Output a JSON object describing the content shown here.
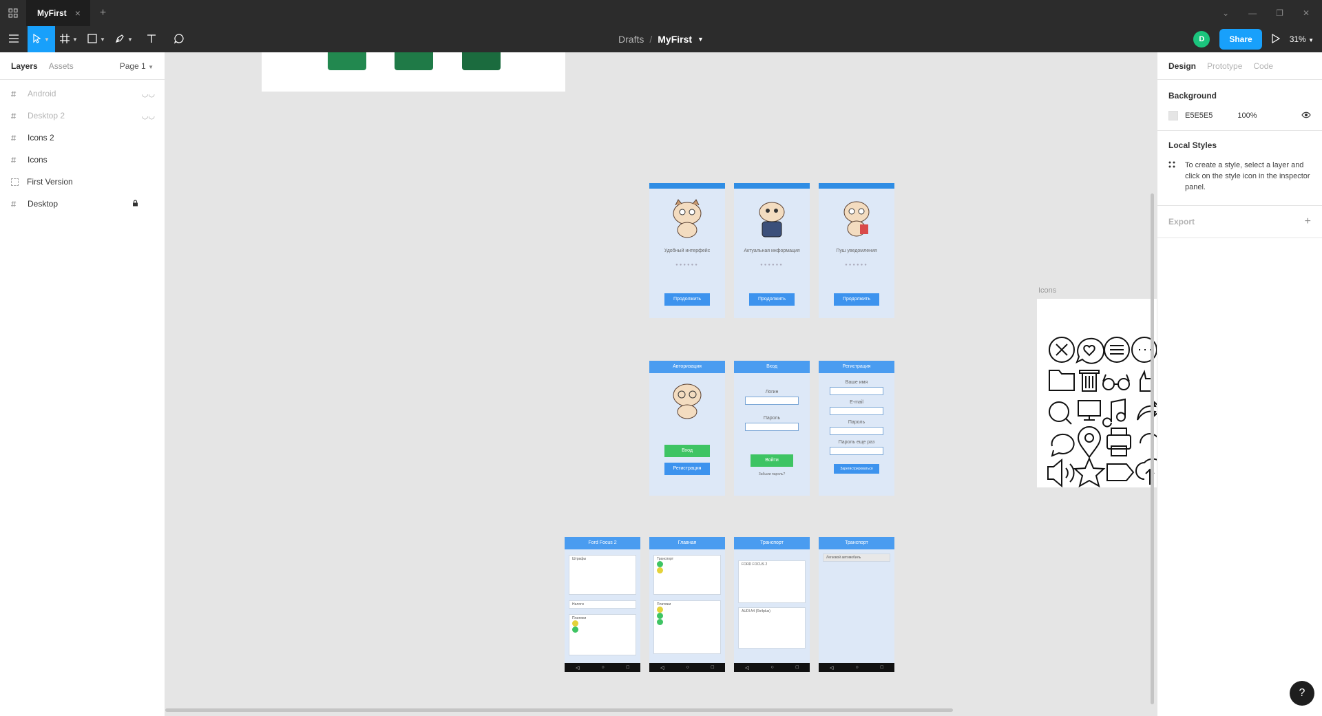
{
  "titlebar": {
    "tab_label": "MyFirst",
    "tab_close": "×",
    "tab_add": "+"
  },
  "toolbar": {
    "breadcrumb": "Drafts",
    "separator": "/",
    "file_name": "MyFirst",
    "avatar_initial": "D",
    "share_label": "Share",
    "zoom_label": "31%"
  },
  "left_panel": {
    "tabs": [
      "Layers",
      "Assets"
    ],
    "page_select": "Page 1",
    "layers": [
      {
        "name": "Android",
        "hidden": true
      },
      {
        "name": "Desktop 2",
        "hidden": true
      },
      {
        "name": "Icons 2",
        "hidden": false
      },
      {
        "name": "Icons",
        "hidden": false
      },
      {
        "name": "First Version",
        "hidden": false
      },
      {
        "name": "Desktop",
        "hidden": false,
        "locked": true
      }
    ]
  },
  "canvas": {
    "icons_frame_label": "Icons",
    "onboarding": [
      {
        "caption": "Удобный интерфейс",
        "button": "Продолжить"
      },
      {
        "caption": "Актуальная информация",
        "button": "Продолжить"
      },
      {
        "caption": "Пуш уведомления",
        "button": "Продолжить"
      }
    ],
    "auth_screens": [
      {
        "title": "Авторизация",
        "btn1": "Вход",
        "btn2": "Регистрация"
      },
      {
        "title": "Вход",
        "label1": "Логин",
        "label2": "Пароль",
        "btn": "Войти",
        "link": "Забыли пароль?"
      },
      {
        "title": "Регистрация",
        "label1": "Ваше имя",
        "label2": "E-mail",
        "label3": "Пароль",
        "label4": "Пароль еще раз",
        "btn": "Зарегистрироваться"
      }
    ],
    "app_screens": [
      {
        "title": "Ford Focus 2",
        "sections": [
          "Штрафы",
          "Налоги",
          "Платежи"
        ]
      },
      {
        "title": "Главная",
        "sections": [
          "Транспорт",
          "Платежи"
        ]
      },
      {
        "title": "Транспорт",
        "sections": [
          "FORD FOCUS 2",
          "AUDI A4 (Rs4plus)"
        ]
      },
      {
        "title": "Транспорт",
        "sections": [
          "Легковой автомобиль"
        ]
      }
    ]
  },
  "right_panel": {
    "tabs": [
      "Design",
      "Prototype",
      "Code"
    ],
    "background_title": "Background",
    "background_hex": "E5E5E5",
    "background_opacity": "100%",
    "local_styles_title": "Local Styles",
    "local_styles_hint": "To create a style, select a layer and click on the style icon in the inspector panel.",
    "export_title": "Export"
  },
  "help_label": "?",
  "colors": {
    "accent": "#18a0fb",
    "dark": "#2c2c2c",
    "canvas": "#e5e5e5",
    "avatar": "#1bc47d"
  }
}
